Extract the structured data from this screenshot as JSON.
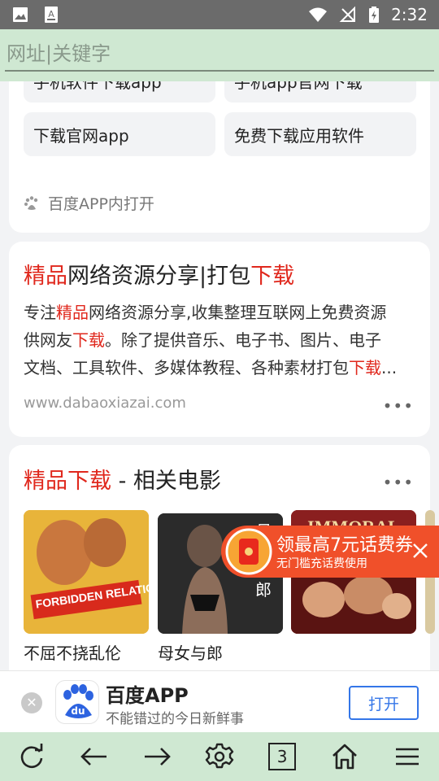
{
  "status_bar": {
    "time": "2:32",
    "icons": [
      "image-icon",
      "text-icon",
      "wifi-icon",
      "no-signal-icon",
      "battery-charging-icon"
    ]
  },
  "url_bar": {
    "placeholder": "网址|关键字"
  },
  "related_searches": {
    "chips": [
      "手机软件下载app",
      "手机app官网下载",
      "下载官网app",
      "免费下载应用软件"
    ],
    "footer_label": "百度APP内打开"
  },
  "result": {
    "title_parts": [
      {
        "text": "精品",
        "red": true
      },
      {
        "text": "网络资源分享|打包",
        "red": false
      },
      {
        "text": "下载",
        "red": true
      }
    ],
    "desc_lines": [
      [
        {
          "text": "专注",
          "red": false
        },
        {
          "text": "精品",
          "red": true
        },
        {
          "text": "网络资源分享,收集整理互联网上免费资源",
          "red": false
        }
      ],
      [
        {
          "text": "供网友",
          "red": false
        },
        {
          "text": "下载",
          "red": true
        },
        {
          "text": "。除了提供音乐、电子书、图片、电子",
          "red": false
        }
      ],
      [
        {
          "text": "文档、工具软件、多媒体教程、各种素材打包",
          "red": false
        },
        {
          "text": "下载",
          "red": true
        },
        {
          "text": "...",
          "red": false
        }
      ]
    ],
    "url": "www.dabaoxiazai.com",
    "more": "•••"
  },
  "movies": {
    "title_red": "精品下载",
    "title_rest": " - 相关电影",
    "more": "•••",
    "items": [
      {
        "caption": "不屈不挠乱伦",
        "poster_text": "FORBIDDEN RELATIONS",
        "color": "#e8b43a"
      },
      {
        "caption": "母女与郎",
        "poster_text": "母女与郎",
        "color": "#2b2b2b"
      },
      {
        "caption": "",
        "poster_text": "IMMORAL TALES",
        "color": "#8a1f1f"
      }
    ]
  },
  "promo": {
    "headline": "领最高7元话费券",
    "subline": "无门槛充话费使用"
  },
  "app_banner": {
    "title": "百度APP",
    "subtitle": "不能错过的今日新鲜事",
    "open_label": "打开",
    "close_label": "✕",
    "logo_text": "du"
  },
  "bottom_nav": {
    "tab_count": "3"
  },
  "colors": {
    "accent_green": "#cfe8d2",
    "highlight_red": "#e0281d",
    "link_blue": "#3476e8",
    "promo_orange": "#f0502a"
  }
}
